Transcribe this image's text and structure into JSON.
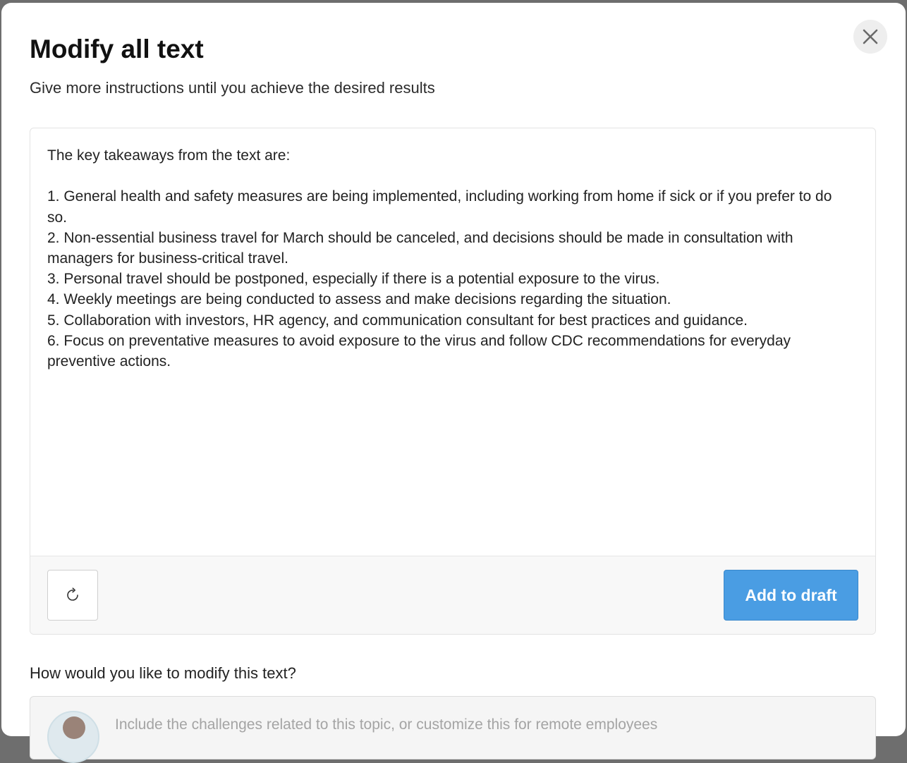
{
  "modal": {
    "title": "Modify all text",
    "subtitle": "Give more instructions until you achieve the desired results"
  },
  "result": {
    "text": "The key takeaways from the text are:\n\n1. General health and safety measures are being implemented, including working from home if sick or if you prefer to do so.\n2. Non-essential business travel for March should be canceled, and decisions should be made in consultation with managers for business-critical travel.\n3. Personal travel should be postponed, especially if there is a potential exposure to the virus.\n4. Weekly meetings are being conducted to assess and make decisions regarding the situation.\n5. Collaboration with investors, HR agency, and communication consultant for best practices and guidance.\n6. Focus on preventative measures to avoid exposure to the virus and follow CDC recommendations for everyday preventive actions."
  },
  "actions": {
    "add_to_draft_label": "Add to draft"
  },
  "modify": {
    "label": "How would you like to modify this text?",
    "placeholder": "Include the challenges related to this topic, or customize this for remote employees"
  },
  "icons": {
    "close": "close-icon",
    "regenerate": "refresh-icon"
  },
  "colors": {
    "primary_button": "#4a9de3",
    "overlay": "#6e6e6e"
  }
}
